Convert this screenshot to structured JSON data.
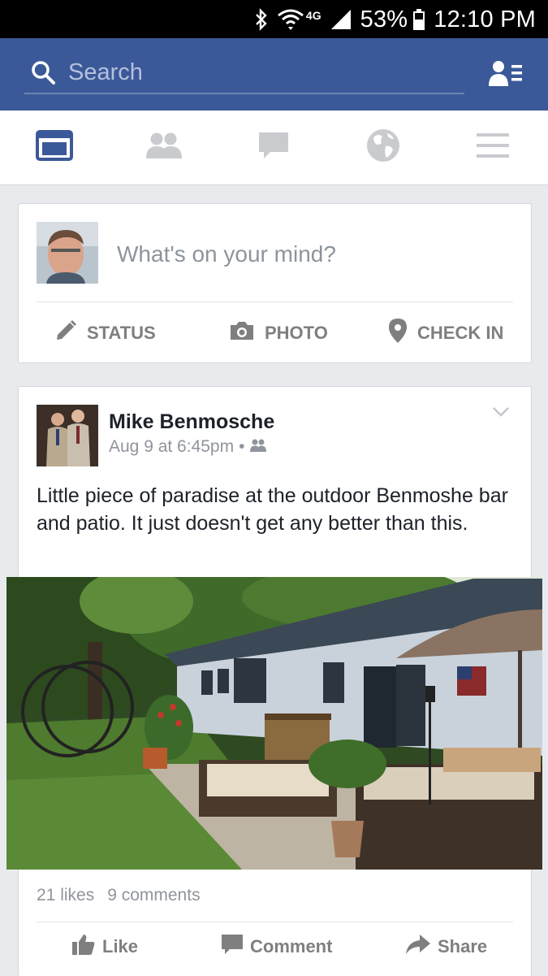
{
  "status_bar": {
    "battery": "53%",
    "time": "12:10 PM",
    "network": "4G",
    "icons": [
      "bluetooth-icon",
      "wifi-icon",
      "signal-icon",
      "battery-icon"
    ]
  },
  "header": {
    "search_placeholder": "Search",
    "friend_requests_icon": "friend-requests-icon"
  },
  "nav": {
    "items": [
      {
        "name": "news-feed",
        "icon": "news-feed-icon",
        "active": true
      },
      {
        "name": "friends",
        "icon": "friends-icon",
        "active": false
      },
      {
        "name": "messages",
        "icon": "chat-bubble-icon",
        "active": false
      },
      {
        "name": "notifications",
        "icon": "globe-icon",
        "active": false
      },
      {
        "name": "more",
        "icon": "hamburger-menu-icon",
        "active": false
      }
    ]
  },
  "composer": {
    "prompt": "What's on your mind?",
    "actions": [
      {
        "label": "STATUS",
        "icon": "pencil-icon"
      },
      {
        "label": "PHOTO",
        "icon": "camera-icon"
      },
      {
        "label": "CHECK IN",
        "icon": "location-pin-icon"
      }
    ]
  },
  "post": {
    "author": "Mike Benmosche",
    "timestamp": "Aug 9 at 6:45pm",
    "audience_icon": "friends-audience-icon",
    "text": "Little piece of paradise at the outdoor Benmoshe bar and patio. It just doesn't get any better than this.",
    "likes": "21 likes",
    "comments": "9 comments",
    "actions": [
      {
        "label": "Like",
        "icon": "thumbs-up-icon"
      },
      {
        "label": "Comment",
        "icon": "comment-icon"
      },
      {
        "label": "Share",
        "icon": "share-arrow-icon"
      }
    ]
  },
  "colors": {
    "brand": "#3b5998",
    "active_nav": "#3b5998",
    "inactive_nav": "#c9cbcf",
    "muted_text": "#90949c"
  }
}
